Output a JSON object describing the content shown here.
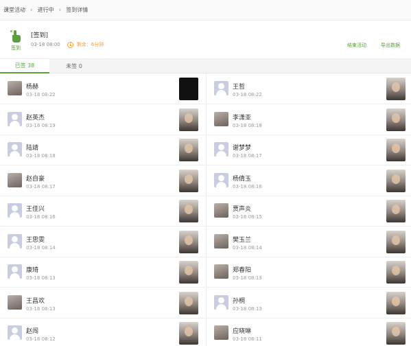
{
  "breadcrumb": [
    "课堂活动",
    "进行中",
    "签到详情"
  ],
  "activity": {
    "icon_label": "签到",
    "title": "[签到]",
    "start": "03-18 08:00",
    "remaining": "剩余：6分钟",
    "actions": [
      "结束活动",
      "导出数据"
    ]
  },
  "tabs": [
    {
      "label": "已签 38",
      "active": true
    },
    {
      "label": "未签 0",
      "active": false
    }
  ],
  "records": [
    {
      "name": "杨赫",
      "time": "03-18 08:22",
      "avatar": "photo",
      "thumb": "dark"
    },
    {
      "name": "王哲",
      "time": "03-18 08:22",
      "avatar": "default",
      "thumb": "photo"
    },
    {
      "name": "赵英杰",
      "time": "03-18 08:19",
      "avatar": "default",
      "thumb": "photo"
    },
    {
      "name": "李潇亚",
      "time": "03-18 08:18",
      "avatar": "photo",
      "thumb": "photo"
    },
    {
      "name": "陆靖",
      "time": "03-18 08:18",
      "avatar": "default",
      "thumb": "photo"
    },
    {
      "name": "谢梦梦",
      "time": "03-18 08:17",
      "avatar": "default",
      "thumb": "photo"
    },
    {
      "name": "赵自豪",
      "time": "03-18 08:17",
      "avatar": "photo",
      "thumb": "photo"
    },
    {
      "name": "杨倩玉",
      "time": "03-18 08:16",
      "avatar": "default",
      "thumb": "photo"
    },
    {
      "name": "王佳兴",
      "time": "03-18 08:16",
      "avatar": "default",
      "thumb": "photo"
    },
    {
      "name": "贾声炎",
      "time": "03-18 08:15",
      "avatar": "photo",
      "thumb": "photo"
    },
    {
      "name": "王思雯",
      "time": "03-18 08:14",
      "avatar": "default",
      "thumb": "photo"
    },
    {
      "name": "樊玉兰",
      "time": "03-18 08:14",
      "avatar": "photo",
      "thumb": "photo"
    },
    {
      "name": "康琦",
      "time": "03-18 08:13",
      "avatar": "default",
      "thumb": "photo"
    },
    {
      "name": "郑春阳",
      "time": "03-18 08:13",
      "avatar": "photo",
      "thumb": "photo"
    },
    {
      "name": "王昌欢",
      "time": "03-18 08:13",
      "avatar": "photo",
      "thumb": "photo"
    },
    {
      "name": "孙桐",
      "time": "03-18 08:13",
      "avatar": "default",
      "thumb": "photo"
    },
    {
      "name": "赵闯",
      "time": "03-18 08:12",
      "avatar": "default",
      "thumb": "photo"
    },
    {
      "name": "应晓琳",
      "time": "03-18 08:11",
      "avatar": "photo",
      "thumb": "photo"
    }
  ]
}
